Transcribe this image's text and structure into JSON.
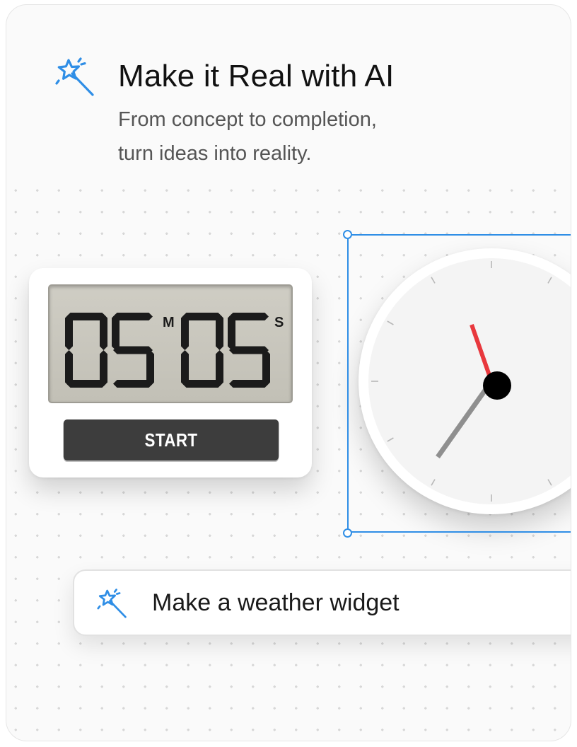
{
  "header": {
    "icon": "magic-wand-icon",
    "title": "Make it Real with AI",
    "subtitle_line1": "From concept to completion,",
    "subtitle_line2": "turn ideas into reality."
  },
  "timer_widget": {
    "minutes": "05",
    "seconds": "05",
    "minutes_unit": "M",
    "seconds_unit": "S",
    "start_label": "START"
  },
  "clock_widget": {
    "icon": "analog-clock",
    "hands": "hour, minute, second"
  },
  "prompt": {
    "icon": "magic-wand-icon",
    "text": "Make a weather widget"
  },
  "colors": {
    "accent": "#2f8ee6",
    "second_hand": "#e8383d",
    "start_button": "#3d3d3d",
    "lcd": "#c9c7be"
  }
}
